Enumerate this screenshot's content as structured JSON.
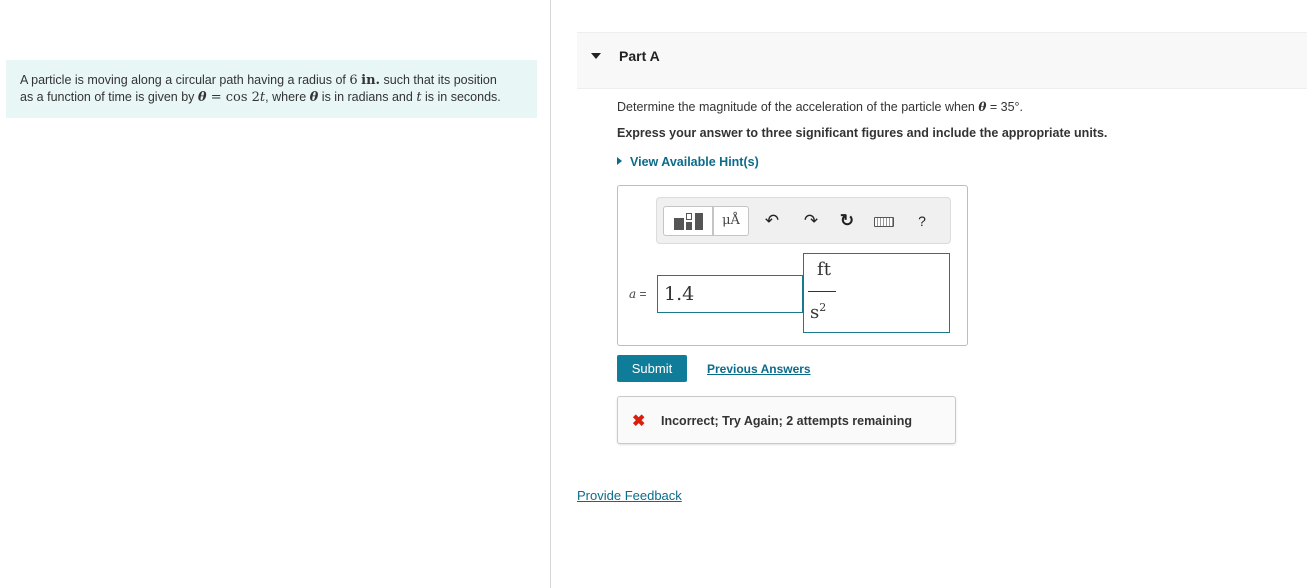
{
  "problem": {
    "text_1": "A particle is moving along a circular path having a radius of",
    "radius_value": "6",
    "radius_unit": "in.",
    "text_2": "such that its position",
    "text_3": "as a function of time is given by",
    "theta_symbol": "θ",
    "equation_rhs": "= cos 2",
    "t_symbol": "t",
    "text_4": ", where",
    "text_5": "is in radians and",
    "text_6": "is in seconds."
  },
  "part": {
    "title": "Part A"
  },
  "question": {
    "text": "Determine the magnitude of the acceleration of the particle when",
    "theta": "θ",
    "condition": "= 35°",
    "period": "."
  },
  "instruction": "Express your answer to three significant figures and include the appropriate units.",
  "hint": {
    "label": "View Available Hint(s)"
  },
  "toolbar": {
    "unit_label": "μÅ",
    "undo_glyph": "↶",
    "redo_glyph": "↷",
    "reset_glyph": "↻",
    "help_label": "?"
  },
  "answer": {
    "variable": "a",
    "equals": "=",
    "value": "1.4",
    "unit_numerator": "ft",
    "unit_denominator": "s",
    "unit_exponent": "2"
  },
  "actions": {
    "submit_label": "Submit",
    "previous_answers_label": "Previous Answers"
  },
  "feedback": {
    "icon": "✖",
    "message": "Incorrect; Try Again; 2 attempts remaining"
  },
  "footer": {
    "provide_feedback_label": "Provide Feedback"
  },
  "colors": {
    "accent": "#0f7d99",
    "link": "#0a6c8a",
    "error": "#d9200e",
    "problem_bg": "#e9f6f6"
  }
}
